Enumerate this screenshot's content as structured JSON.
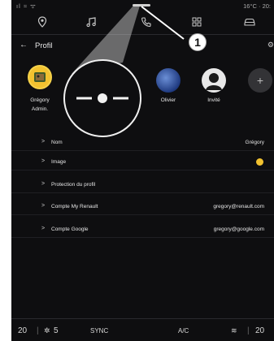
{
  "status": {
    "left": "ıl ≈ ᯤ",
    "right": "16°C · 20:"
  },
  "nav_icons": [
    "location-pin-icon",
    "music-note-icon",
    "phone-icon",
    "apps-grid-icon",
    "car-icon"
  ],
  "header": {
    "back_glyph": "←",
    "title": "Profil",
    "settings_glyph": "⚙"
  },
  "profiles": [
    {
      "name": "Grégory",
      "role": "Admin."
    },
    {
      "name": "Olivier"
    },
    {
      "name": "Invité"
    }
  ],
  "add_profile_glyph": "+",
  "menu": [
    {
      "label": "Nom",
      "value": "Grégory"
    },
    {
      "label": "Image",
      "value": ""
    },
    {
      "label": "Protection du profil",
      "value": ""
    },
    {
      "label": "Compte My Renault",
      "value": "gregory@renault.com"
    },
    {
      "label": "Compte Google",
      "value": "gregory@google.com"
    }
  ],
  "chevron_glyph": ">",
  "callout": {
    "number": "1"
  },
  "bottom": {
    "temp_left": "20",
    "fan_speed": "5",
    "sync": "SYNC",
    "ac": "A/C",
    "temp_right": "20"
  },
  "colors": {
    "admin_avatar": "#f2c230",
    "olivier_avatar": "#2a4fa0",
    "background": "#0e0e10"
  }
}
